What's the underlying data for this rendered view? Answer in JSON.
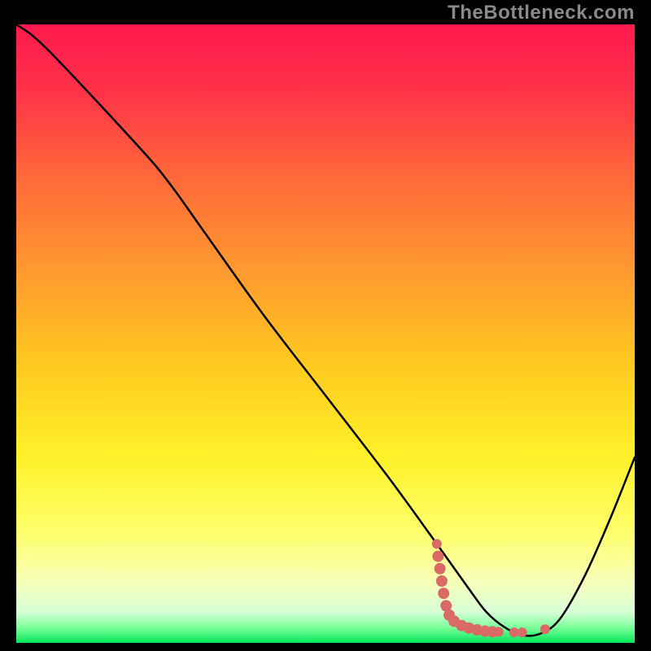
{
  "watermark": "TheBottleneck.com",
  "chart_data": {
    "type": "line",
    "title": "",
    "xlabel": "",
    "ylabel": "",
    "xlim": [
      0,
      100
    ],
    "ylim": [
      0,
      100
    ],
    "background_gradient_stops": [
      {
        "offset": 0.0,
        "color": "#ff1a4d"
      },
      {
        "offset": 0.1,
        "color": "#ff2f49"
      },
      {
        "offset": 0.25,
        "color": "#ff6a3a"
      },
      {
        "offset": 0.4,
        "color": "#ff9a2f"
      },
      {
        "offset": 0.55,
        "color": "#ffc91f"
      },
      {
        "offset": 0.7,
        "color": "#fff12a"
      },
      {
        "offset": 0.82,
        "color": "#feff6a"
      },
      {
        "offset": 0.9,
        "color": "#f8ffb8"
      },
      {
        "offset": 0.95,
        "color": "#d8ffd8"
      },
      {
        "offset": 0.975,
        "color": "#7dff9a"
      },
      {
        "offset": 1.0,
        "color": "#00e858"
      }
    ],
    "series": [
      {
        "name": "bottleneck-curve",
        "color": "#000000",
        "x": [
          0,
          5,
          20,
          25,
          30,
          40,
          50,
          60,
          68,
          73,
          76,
          79,
          82,
          85,
          88,
          92,
          96,
          100
        ],
        "values": [
          100,
          96,
          80,
          74,
          67,
          53,
          40,
          27,
          16,
          9,
          5,
          2.5,
          1.2,
          1.6,
          4,
          11,
          20,
          30
        ]
      }
    ],
    "scatter": {
      "name": "highlight-points",
      "color": "#d96a66",
      "points": [
        {
          "x": 68.0,
          "y": 16.0,
          "r": 6
        },
        {
          "x": 68.2,
          "y": 14.0,
          "r": 7
        },
        {
          "x": 68.5,
          "y": 12.0,
          "r": 7
        },
        {
          "x": 68.8,
          "y": 10.0,
          "r": 7
        },
        {
          "x": 69.1,
          "y": 8.0,
          "r": 7
        },
        {
          "x": 69.5,
          "y": 6.0,
          "r": 7
        },
        {
          "x": 70.0,
          "y": 4.5,
          "r": 7
        },
        {
          "x": 70.8,
          "y": 3.5,
          "r": 7
        },
        {
          "x": 72.0,
          "y": 2.8,
          "r": 7
        },
        {
          "x": 73.2,
          "y": 2.4,
          "r": 7
        },
        {
          "x": 74.5,
          "y": 2.1,
          "r": 7
        },
        {
          "x": 75.8,
          "y": 1.9,
          "r": 7
        },
        {
          "x": 77.0,
          "y": 1.8,
          "r": 7
        },
        {
          "x": 78.0,
          "y": 1.8,
          "r": 6
        },
        {
          "x": 80.5,
          "y": 1.7,
          "r": 6
        },
        {
          "x": 81.8,
          "y": 1.7,
          "r": 6
        },
        {
          "x": 85.5,
          "y": 2.2,
          "r": 6
        }
      ]
    }
  }
}
